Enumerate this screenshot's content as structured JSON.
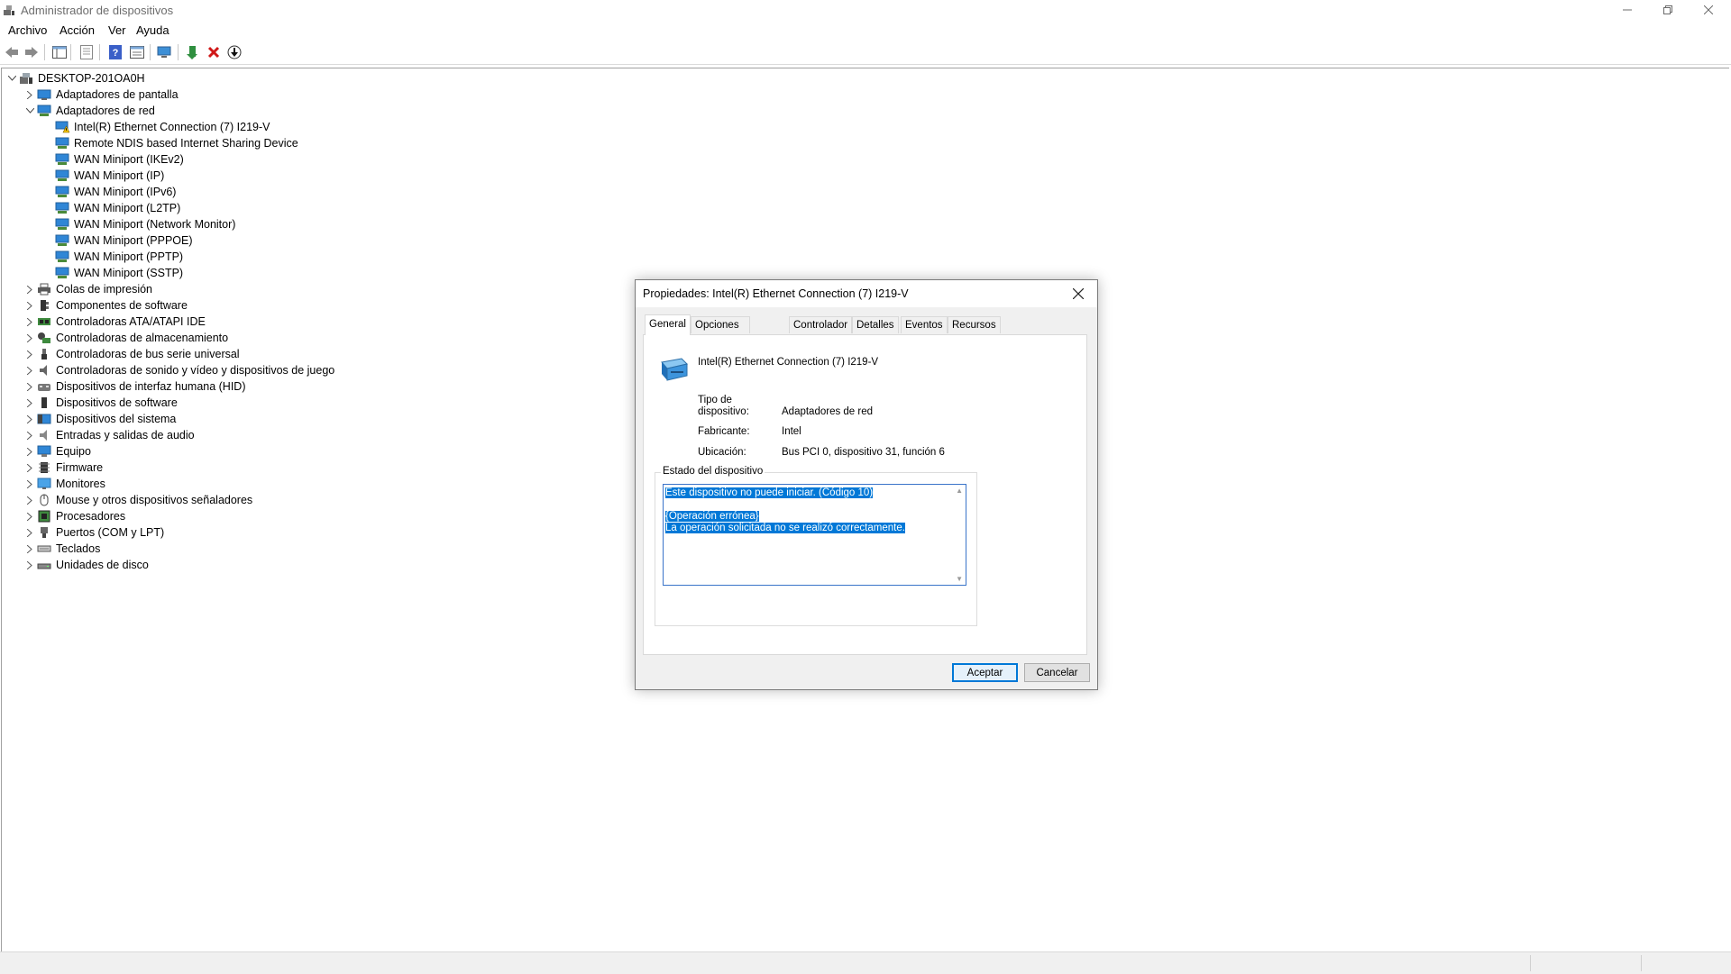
{
  "window": {
    "title": "Administrador de dispositivos"
  },
  "menu": [
    "Archivo",
    "Acción",
    "Ver",
    "Ayuda"
  ],
  "tree": {
    "root": "DESKTOP-201OA0H",
    "categories": [
      {
        "label": "Adaptadores de pantalla",
        "expanded": false,
        "icon": "display-adapter-icon"
      },
      {
        "label": "Adaptadores de red",
        "expanded": true,
        "icon": "network-adapter-icon",
        "children": [
          {
            "label": "Intel(R) Ethernet Connection (7) I219-V",
            "warning": true
          },
          {
            "label": "Remote NDIS based Internet Sharing Device"
          },
          {
            "label": "WAN Miniport (IKEv2)"
          },
          {
            "label": "WAN Miniport (IP)"
          },
          {
            "label": "WAN Miniport (IPv6)"
          },
          {
            "label": "WAN Miniport (L2TP)"
          },
          {
            "label": "WAN Miniport (Network Monitor)"
          },
          {
            "label": "WAN Miniport (PPPOE)"
          },
          {
            "label": "WAN Miniport (PPTP)"
          },
          {
            "label": "WAN Miniport (SSTP)"
          }
        ]
      },
      {
        "label": "Colas de impresión",
        "expanded": false,
        "icon": "printer-icon"
      },
      {
        "label": "Componentes de software",
        "expanded": false,
        "icon": "software-component-icon"
      },
      {
        "label": "Controladoras ATA/ATAPI IDE",
        "expanded": false,
        "icon": "ide-controller-icon"
      },
      {
        "label": "Controladoras de almacenamiento",
        "expanded": false,
        "icon": "storage-controller-icon"
      },
      {
        "label": "Controladoras de bus serie universal",
        "expanded": false,
        "icon": "usb-icon"
      },
      {
        "label": "Controladoras de sonido y vídeo y dispositivos de juego",
        "expanded": false,
        "icon": "speaker-icon"
      },
      {
        "label": "Dispositivos de interfaz humana (HID)",
        "expanded": false,
        "icon": "hid-icon"
      },
      {
        "label": "Dispositivos de software",
        "expanded": false,
        "icon": "software-device-icon"
      },
      {
        "label": "Dispositivos del sistema",
        "expanded": false,
        "icon": "system-device-icon"
      },
      {
        "label": "Entradas y salidas de audio",
        "expanded": false,
        "icon": "audio-io-icon"
      },
      {
        "label": "Equipo",
        "expanded": false,
        "icon": "computer-icon"
      },
      {
        "label": "Firmware",
        "expanded": false,
        "icon": "firmware-icon"
      },
      {
        "label": "Monitores",
        "expanded": false,
        "icon": "monitor-icon"
      },
      {
        "label": "Mouse y otros dispositivos señaladores",
        "expanded": false,
        "icon": "mouse-icon"
      },
      {
        "label": "Procesadores",
        "expanded": false,
        "icon": "processor-icon"
      },
      {
        "label": "Puertos (COM y LPT)",
        "expanded": false,
        "icon": "port-icon"
      },
      {
        "label": "Teclados",
        "expanded": false,
        "icon": "keyboard-icon"
      },
      {
        "label": "Unidades de disco",
        "expanded": false,
        "icon": "disk-drive-icon"
      }
    ]
  },
  "dialog": {
    "title": "Propiedades: Intel(R) Ethernet Connection (7) I219-V",
    "tabs": [
      "General",
      "Opciones avanzadas",
      "Controlador",
      "Detalles",
      "Eventos",
      "Recursos"
    ],
    "active_tab": "General",
    "device_name": "Intel(R) Ethernet Connection (7) I219-V",
    "props": {
      "tipo_label_line1": "Tipo de",
      "tipo_label_line2": "dispositivo:",
      "tipo_value": "Adaptadores de red",
      "fabricante_label": "Fabricante:",
      "fabricante_value": "Intel",
      "ubicacion_label": "Ubicación:",
      "ubicacion_value": "Bus PCI 0, dispositivo 31, función 6"
    },
    "status_group_title": "Estado del dispositivo",
    "status_lines": [
      "Este dispositivo no puede iniciar. (Código 10)",
      "",
      "{Operación errónea}",
      "La operación solicitada no se realizó correctamente."
    ],
    "buttons": {
      "ok": "Aceptar",
      "cancel": "Cancelar"
    }
  },
  "colors": {
    "selection": "#0078d7",
    "window_bg": "#ffffff",
    "dialog_bg": "#f0f0f0"
  }
}
